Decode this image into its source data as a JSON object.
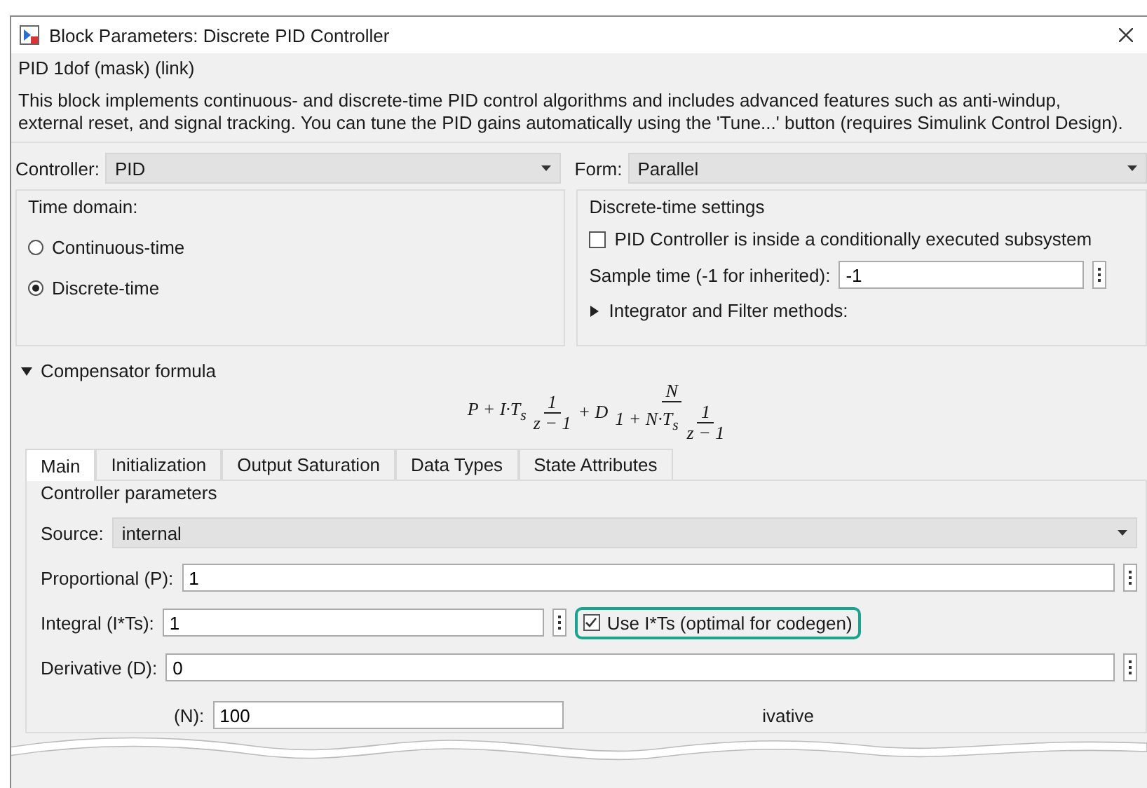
{
  "window": {
    "title": "Block Parameters: Discrete PID Controller"
  },
  "mask_title": "PID 1dof (mask) (link)",
  "description": "This block implements continuous- and discrete-time PID control algorithms and includes advanced features such as anti-windup, external reset, and signal tracking. You can tune the PID gains automatically using the 'Tune...' button (requires Simulink Control Design).",
  "controller": {
    "label": "Controller:",
    "value": "PID"
  },
  "form": {
    "label": "Form:",
    "value": "Parallel"
  },
  "time_domain": {
    "title": "Time domain:",
    "options": [
      {
        "label": "Continuous-time",
        "selected": false
      },
      {
        "label": "Discrete-time",
        "selected": true
      }
    ]
  },
  "discrete_settings": {
    "title": "Discrete-time settings",
    "checkbox": {
      "label": "PID Controller is inside a conditionally executed subsystem",
      "checked": false
    },
    "sample_time": {
      "label": "Sample time (-1 for inherited):",
      "value": "-1"
    },
    "methods": {
      "label": "Integrator and Filter methods:",
      "expanded": false
    }
  },
  "compensator": {
    "label": "Compensator formula",
    "expanded": true,
    "formula": {
      "prefix": "P + I·T$_{s}$",
      "frac1": {
        "num": "1",
        "den": "z − 1"
      },
      "middle": "+ D",
      "frac2": {
        "num": "N",
        "den_prefix": "1 + N·T$_{s}$",
        "den_frac": {
          "num": "1",
          "den": "z − 1"
        }
      }
    }
  },
  "tabs": [
    {
      "label": "Main",
      "selected": true
    },
    {
      "label": "Initialization",
      "selected": false
    },
    {
      "label": "Output Saturation",
      "selected": false
    },
    {
      "label": "Data Types",
      "selected": false
    },
    {
      "label": "State Attributes",
      "selected": false
    }
  ],
  "parameters": {
    "title": "Controller parameters",
    "rows": [
      {
        "kind": "dropdown",
        "label": "Source:",
        "value": "internal"
      },
      {
        "kind": "field",
        "label": "Proportional (P):",
        "value": "1"
      },
      {
        "kind": "half",
        "label": "Integral (I*Ts):",
        "value": "1",
        "checkbox": {
          "label": "Use I*Ts (optimal for codegen)",
          "checked": true,
          "highlighted": true
        }
      },
      {
        "kind": "field",
        "label": "Derivative (D):",
        "value": "0"
      },
      {
        "kind": "torn",
        "label": "(N):",
        "value": "100",
        "side_text": "ivative"
      }
    ]
  }
}
